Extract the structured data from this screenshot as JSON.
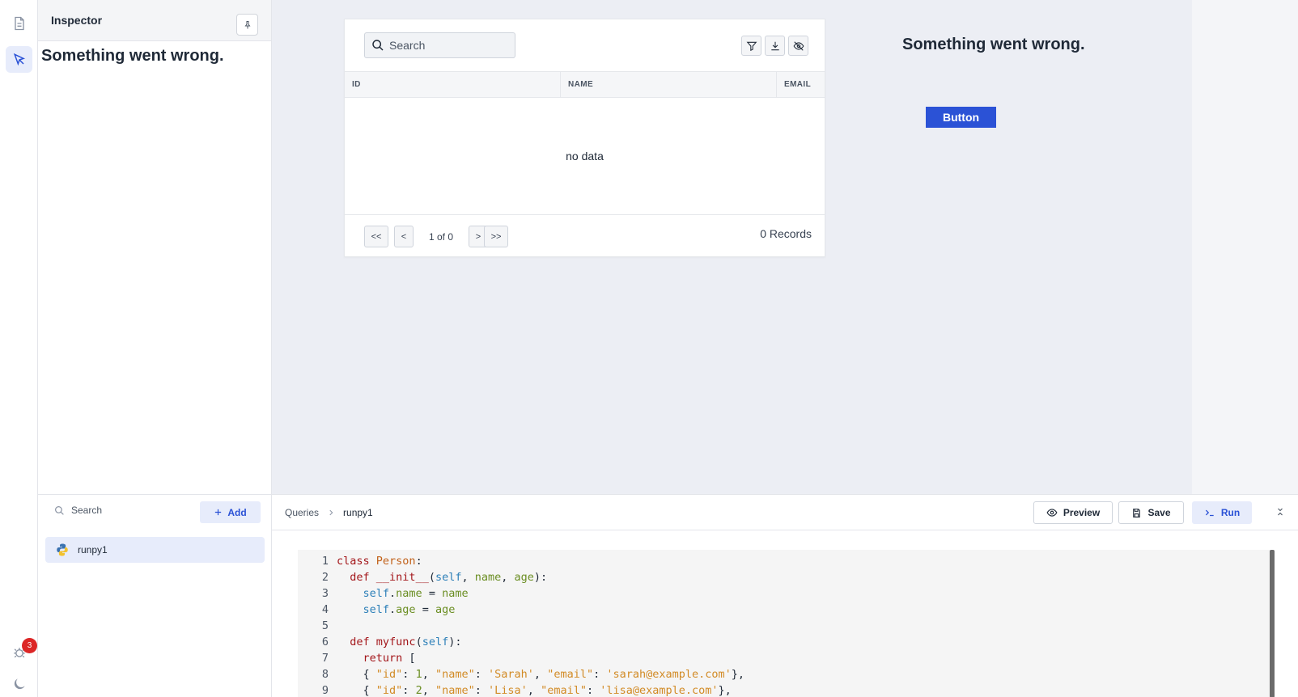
{
  "inspector": {
    "title": "Inspector",
    "error": "Something went wrong."
  },
  "rail": {
    "notification_count": "3"
  },
  "table_widget": {
    "search_placeholder": "Search",
    "columns": [
      "ID",
      "NAME",
      "EMAIL"
    ],
    "empty_text": "no data",
    "pagination": {
      "first": "<<",
      "prev": "<",
      "info": "1 of 0",
      "next": ">",
      "last": ">>"
    },
    "records": "0 Records"
  },
  "canvas": {
    "error": "Something went wrong.",
    "button_label": "Button"
  },
  "query_list": {
    "search_placeholder": "Search",
    "add_label": "Add",
    "items": [
      {
        "label": "runpy1",
        "icon": "python-icon"
      }
    ]
  },
  "query_editor": {
    "breadcrumb": [
      "Queries",
      "runpy1"
    ],
    "preview_label": "Preview",
    "save_label": "Save",
    "run_label": "Run"
  },
  "code_lines": [
    "class Person:",
    "  def __init__(self, name, age):",
    "    self.name = name",
    "    self.age = age",
    "",
    "  def myfunc(self):",
    "    return [",
    "    { \"id\": 1, \"name\": 'Sarah', \"email\": 'sarah@example.com'},",
    "    { \"id\": 2, \"name\": 'Lisa', \"email\": 'lisa@example.com'},"
  ],
  "colors": {
    "accent": "#2b52d6",
    "accent_light": "#e7ecfb",
    "canvas_bg": "#eceef4",
    "badge": "#dc2626"
  }
}
